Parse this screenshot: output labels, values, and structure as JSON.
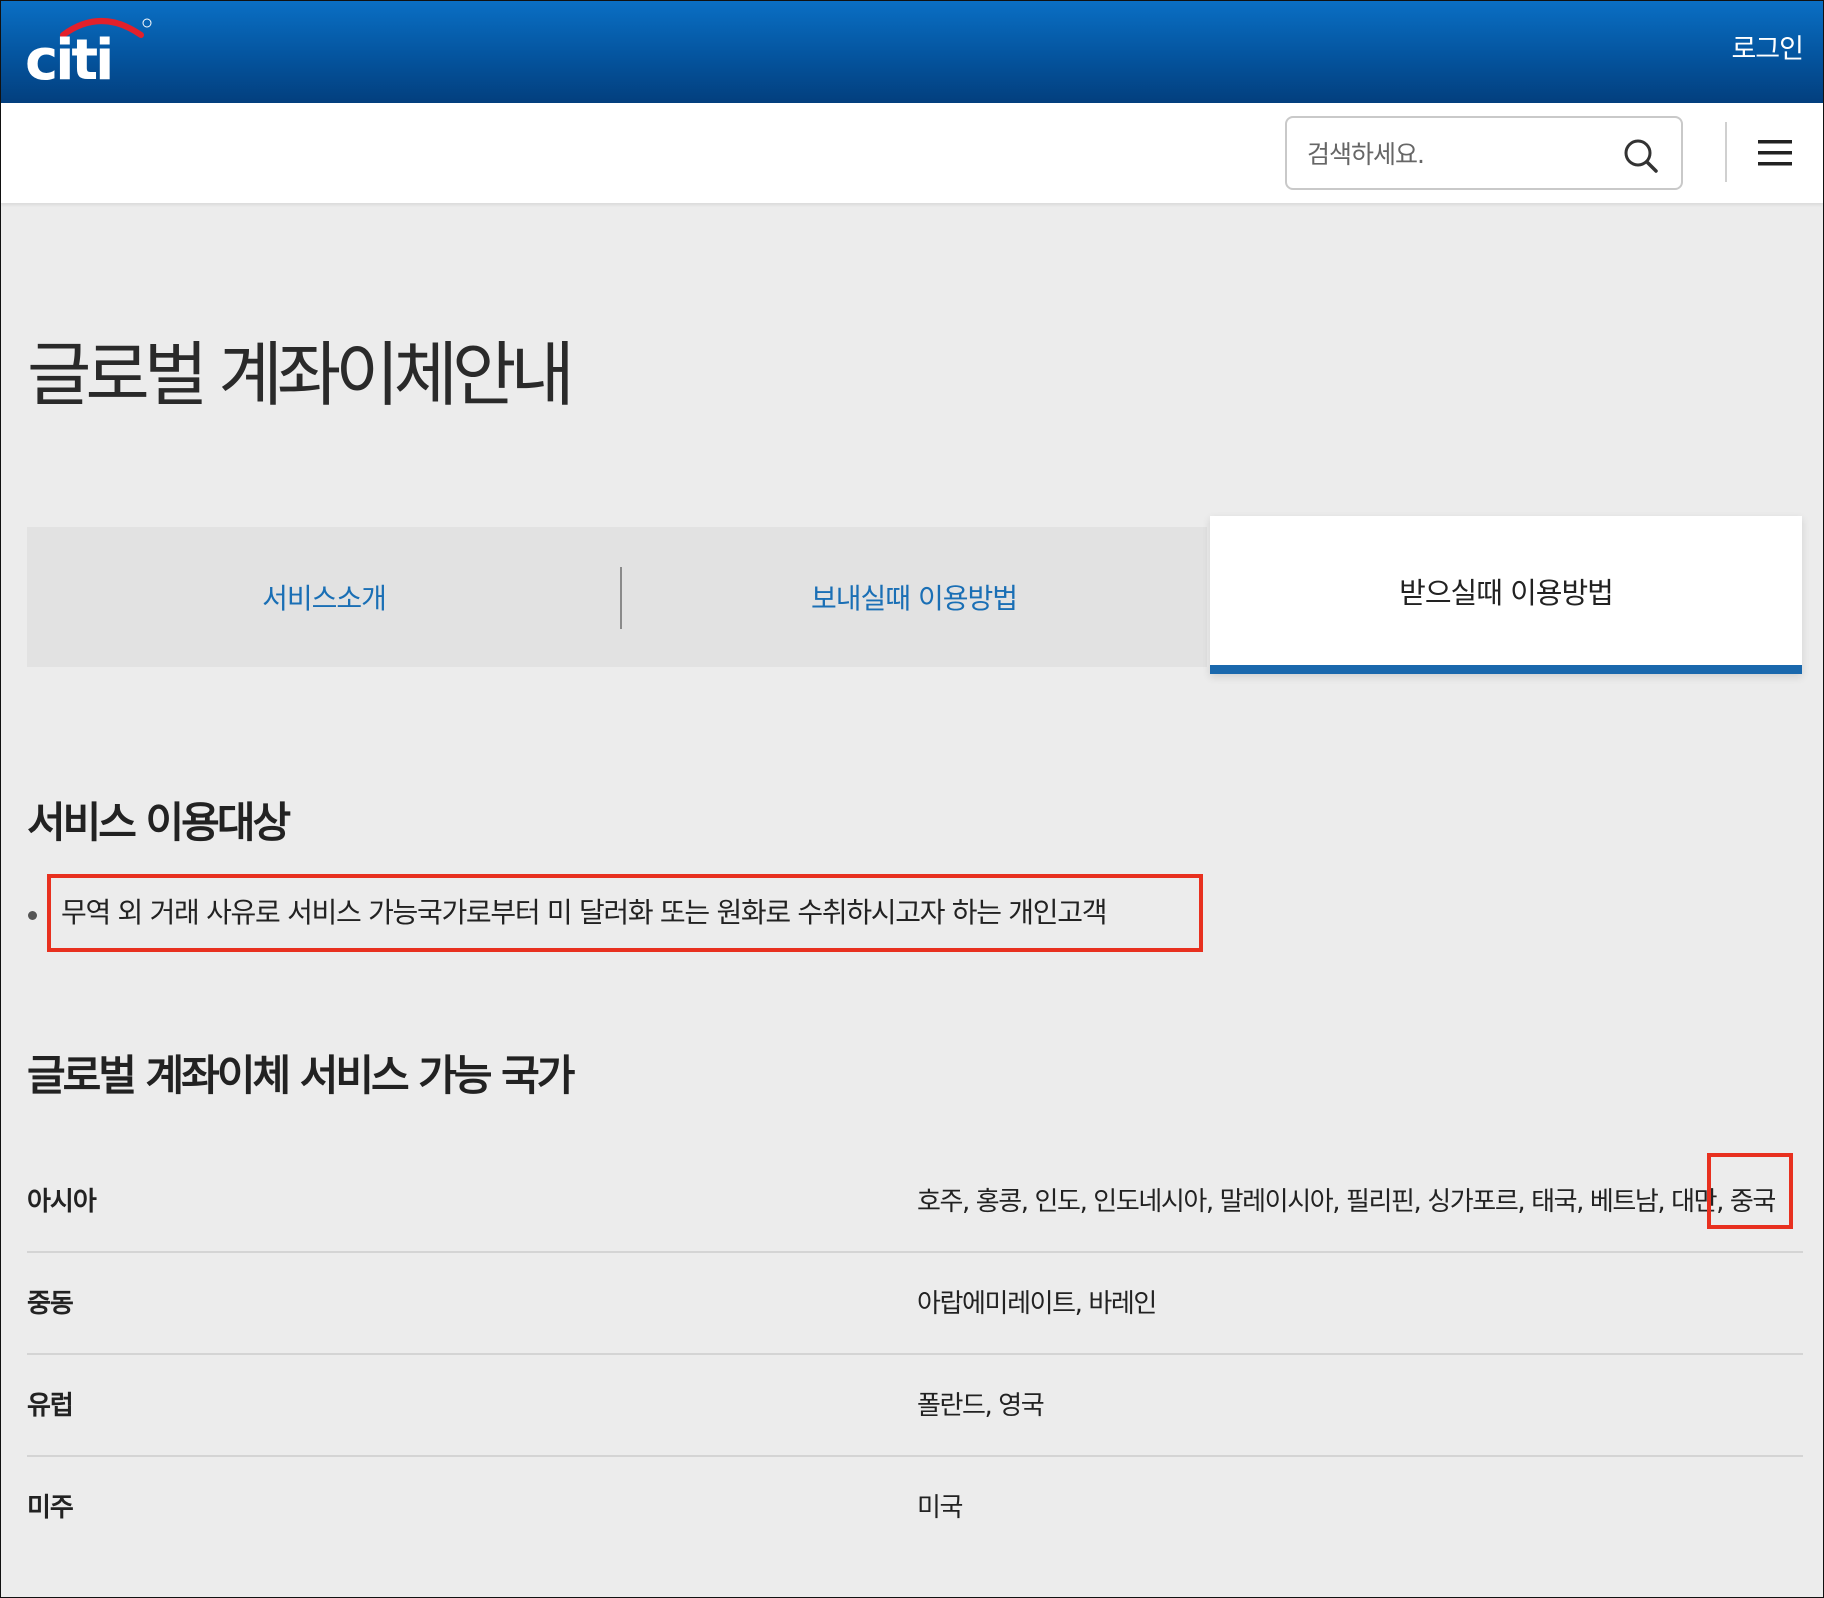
{
  "brand": {
    "logo_text": "citi",
    "logo_arc_color": "#e3202b",
    "topbar_color": "#0561ae"
  },
  "topbar": {
    "login_label": "로그인"
  },
  "header": {
    "search_placeholder": "검색하세요.",
    "search_icon": "search-icon",
    "menu_icon": "hamburger-menu-icon"
  },
  "page": {
    "title": "글로벌 계좌이체안내"
  },
  "tabs": [
    {
      "label": "서비스소개",
      "active": false
    },
    {
      "label": "보내실때 이용방법",
      "active": false
    },
    {
      "label": "받으실때 이용방법",
      "active": true
    }
  ],
  "colors": {
    "tab_link": "#1a6fb5",
    "active_tab_underline": "#1a68ad",
    "highlight_box": "#e8301f"
  },
  "section_target": {
    "heading": "서비스 이용대상",
    "bullets": [
      "무역 외 거래 사유로 서비스 가능국가로부터 미 달러화 또는 원화로 수취하시고자 하는 개인고객"
    ]
  },
  "section_countries": {
    "heading": "글로벌 계좌이체 서비스 가능 국가",
    "rows": [
      {
        "region": "아시아",
        "countries": "호주, 홍콩, 인도, 인도네시아, 말레이시아, 필리핀, 싱가포르, 태국, 베트남, 대만, 중국"
      },
      {
        "region": "중동",
        "countries": "아랍에미레이트, 바레인"
      },
      {
        "region": "유럽",
        "countries": "폴란드, 영국"
      },
      {
        "region": "미주",
        "countries": "미국"
      }
    ]
  }
}
